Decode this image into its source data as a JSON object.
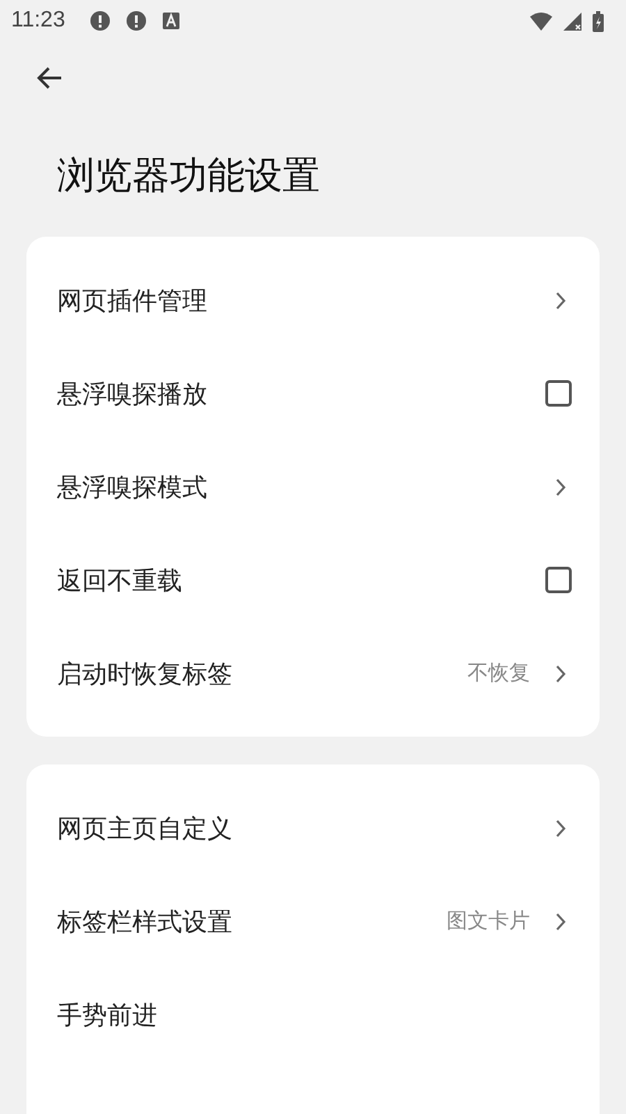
{
  "status_bar": {
    "time": "11:23"
  },
  "title": "浏览器功能设置",
  "groups": [
    {
      "items": [
        {
          "label": "网页插件管理",
          "kind": "link"
        },
        {
          "label": "悬浮嗅探播放",
          "kind": "checkbox",
          "checked": false
        },
        {
          "label": "悬浮嗅探模式",
          "kind": "link"
        },
        {
          "label": "返回不重载",
          "kind": "checkbox",
          "checked": false
        },
        {
          "label": "启动时恢复标签",
          "kind": "link",
          "value": "不恢复"
        }
      ]
    },
    {
      "items": [
        {
          "label": "网页主页自定义",
          "kind": "link"
        },
        {
          "label": "标签栏样式设置",
          "kind": "link",
          "value": "图文卡片"
        },
        {
          "label": "手势前进",
          "kind": "plain"
        }
      ]
    }
  ]
}
